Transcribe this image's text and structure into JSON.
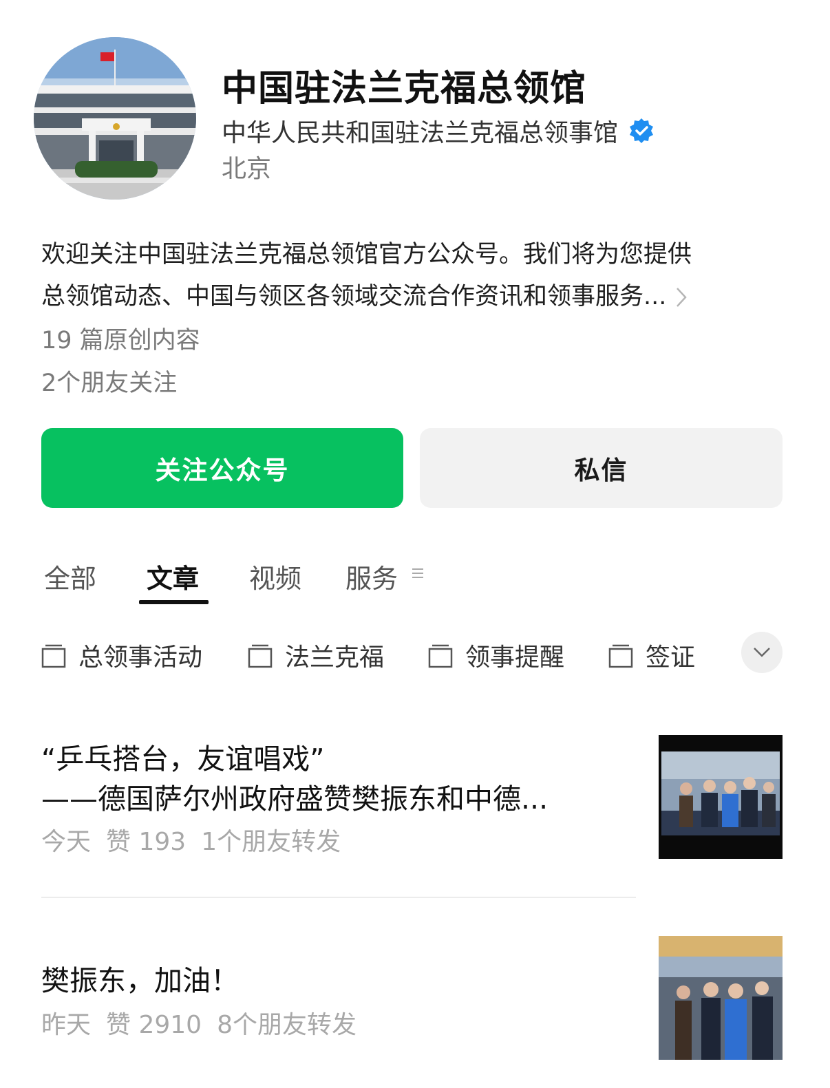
{
  "profile": {
    "account_name": "中国驻法兰克福总领馆",
    "full_name": "中华人民共和国驻法兰克福总领事馆",
    "location": "北京",
    "description_line1": "欢迎关注中国驻法兰克福总领馆官方公众号。我们将为您提供",
    "description_line2": "总领馆动态、中国与领区各领域交流合作资讯和领事服务...",
    "original_count": "19 篇原创内容",
    "friends_following": "2个朋友关注"
  },
  "actions": {
    "follow_label": "关注公众号",
    "message_label": "私信"
  },
  "tabs": [
    {
      "label": "全部"
    },
    {
      "label": "文章"
    },
    {
      "label": "视频"
    },
    {
      "label": "服务"
    }
  ],
  "categories": [
    {
      "label": "总领事活动"
    },
    {
      "label": "法兰克福"
    },
    {
      "label": "领事提醒"
    },
    {
      "label": "签证"
    }
  ],
  "articles": [
    {
      "title_line1": "“乒乓搭台，友谊唱戏”",
      "title_line2": "——德国萨尔州政府盛赞樊振东和中德...",
      "date": "今天",
      "likes": "赞 193",
      "shares": "1个朋友转发"
    },
    {
      "title_line1": "樊振东，加油！",
      "date": "昨天",
      "likes": "赞 2910",
      "shares": "8个朋友转发"
    }
  ],
  "colors": {
    "accent_green": "#07c160",
    "verified_blue": "#1f8ef1"
  }
}
